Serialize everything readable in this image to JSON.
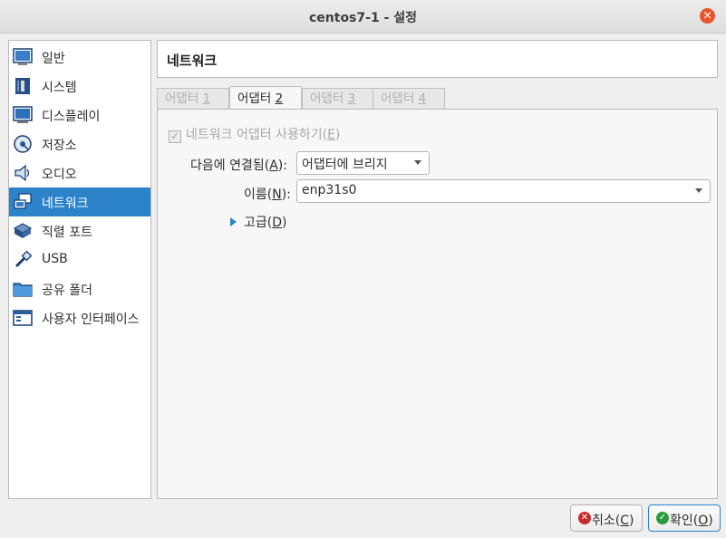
{
  "window": {
    "title": "centos7-1 - 설정"
  },
  "sidebar": {
    "items": [
      {
        "label": "일반",
        "icon": "general-icon"
      },
      {
        "label": "시스템",
        "icon": "system-icon"
      },
      {
        "label": "디스플레이",
        "icon": "display-icon"
      },
      {
        "label": "저장소",
        "icon": "storage-icon"
      },
      {
        "label": "오디오",
        "icon": "audio-icon"
      },
      {
        "label": "네트워크",
        "icon": "network-icon",
        "selected": true
      },
      {
        "label": "직렬 포트",
        "icon": "serial-port-icon"
      },
      {
        "label": "USB",
        "icon": "usb-icon"
      },
      {
        "label": "공유 폴더",
        "icon": "shared-folder-icon"
      },
      {
        "label": "사용자 인터페이스",
        "icon": "user-interface-icon"
      }
    ]
  },
  "page": {
    "title": "네트워크"
  },
  "tabs": [
    {
      "label": "어댑터 ",
      "num": "1",
      "active": false
    },
    {
      "label": "어댑터 ",
      "num": "2",
      "active": true
    },
    {
      "label": "어댑터 ",
      "num": "3",
      "active": false
    },
    {
      "label": "어댑터 ",
      "num": "4",
      "active": false
    }
  ],
  "adapter": {
    "enable_label": "네트워크 어댑터 사용하기",
    "enable_key": "E",
    "enabled": true,
    "attached_label": "다음에 연결됨",
    "attached_key": "A",
    "attached_value": "어댑터에 브리지",
    "name_label": "이름",
    "name_key": "N",
    "name_value": "enp31s0",
    "advanced_label": "고급",
    "advanced_key": "D"
  },
  "buttons": {
    "cancel_label": "취소",
    "cancel_key": "C",
    "ok_label": "확인",
    "ok_key": "O"
  },
  "colors": {
    "accent": "#2c83c9",
    "cancel": "#c72b2b",
    "ok": "#2e9b3a",
    "close": "#e9542b"
  }
}
